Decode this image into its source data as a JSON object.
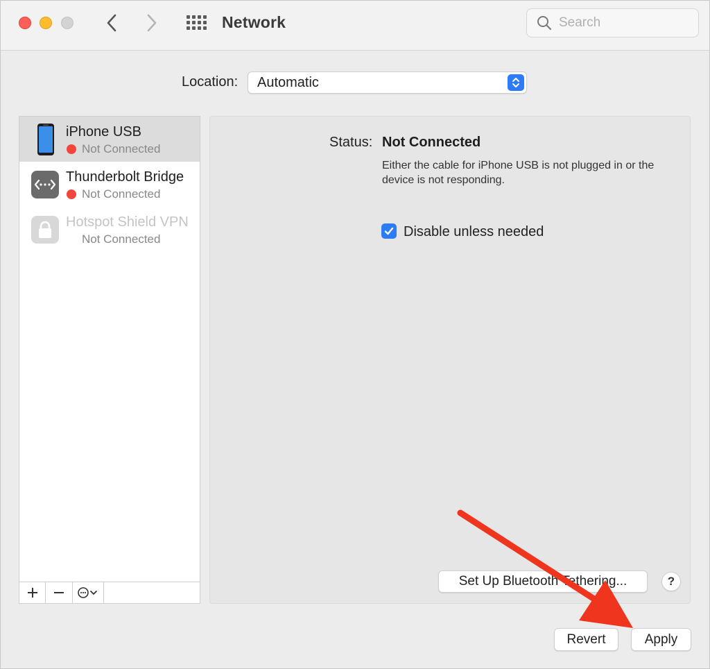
{
  "window": {
    "title": "Network"
  },
  "search": {
    "placeholder": "Search",
    "value": ""
  },
  "location": {
    "label": "Location:",
    "value": "Automatic"
  },
  "services": [
    {
      "name": "iPhone USB",
      "status": "Not Connected",
      "icon": "iphone-icon",
      "selected": true
    },
    {
      "name": "Thunderbolt Bridge",
      "status": "Not Connected",
      "icon": "thunderbolt-bridge-icon",
      "selected": false
    },
    {
      "name": "Hotspot Shield VPN",
      "status": "Not Connected",
      "icon": "lock-icon",
      "selected": false
    }
  ],
  "sidebar_toolbar": {
    "add": "+",
    "remove": "−",
    "action": "action-menu-icon"
  },
  "detail": {
    "status_label": "Status:",
    "status_value": "Not Connected",
    "status_description": "Either the cable for iPhone USB is not plugged in or the device is not responding.",
    "disable_checkbox_label": "Disable unless needed",
    "disable_checked": true,
    "bluetooth_button": "Set Up Bluetooth Tethering...",
    "help_button": "?"
  },
  "footer": {
    "revert": "Revert",
    "apply": "Apply"
  },
  "colors": {
    "accent": "#2d7bf6",
    "status_red": "#f4453d",
    "annotation_arrow": "#f0351f"
  }
}
